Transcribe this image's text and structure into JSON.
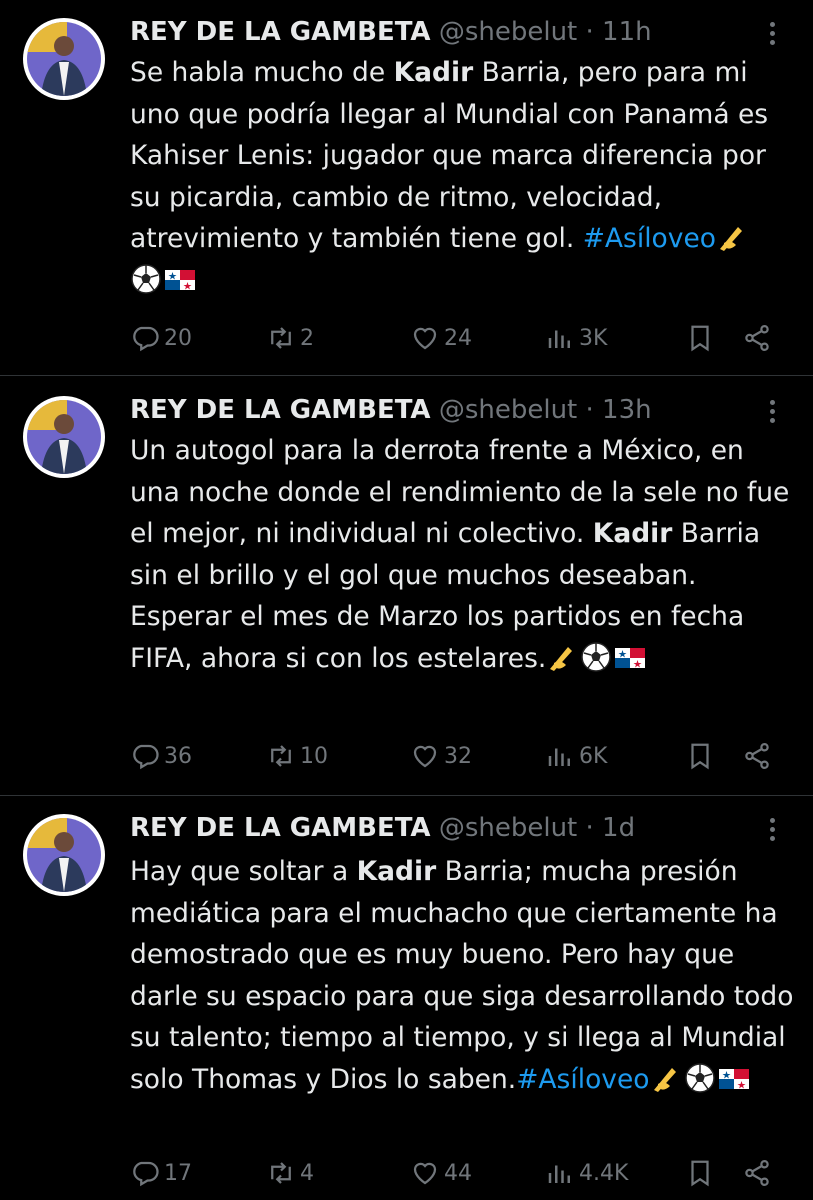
{
  "tweets": [
    {
      "name": "REY DE LA GAMBETA",
      "handle": "@shebelut",
      "separator": "·",
      "time": "11h",
      "text_parts": {
        "a": "Se habla mucho de ",
        "bold": "Kadir",
        "b": " Barria, pero para mi uno que podría llegar al Mundial con Panamá es Kahiser Lenis: jugador que marca diferencia por su picardia, cambio de ritmo, velocidad, atrevimiento y también tiene gol. ",
        "hashtag": "#Asíloveo"
      },
      "emojis": [
        "writing-hand",
        "soccer-ball",
        "panama-flag"
      ],
      "stats": {
        "replies": "20",
        "retweets": "2",
        "likes": "24",
        "views": "3K"
      }
    },
    {
      "name": "REY DE LA GAMBETA",
      "handle": "@shebelut",
      "separator": "·",
      "time": "13h",
      "text_parts": {
        "a": "Un autogol para la derrota frente a México, en una noche donde el rendimiento de la sele no fue el mejor, ni individual ni colectivo. ",
        "bold": "Kadir",
        "b": " Barria sin el brillo y el gol que muchos deseaban. Esperar el mes de Marzo los partidos en fecha FIFA, ahora si con los estelares.",
        "hashtag": ""
      },
      "emojis": [
        "writing-hand",
        "soccer-ball",
        "panama-flag"
      ],
      "stats": {
        "replies": "36",
        "retweets": "10",
        "likes": "32",
        "views": "6K"
      }
    },
    {
      "name": "REY DE LA GAMBETA",
      "handle": "@shebelut",
      "separator": "·",
      "time": "1d",
      "text_parts": {
        "a": "Hay que soltar a ",
        "bold": "Kadir",
        "b": " Barria; mucha presión mediática para el muchacho que ciertamente ha demostrado que es muy bueno. Pero hay que darle su espacio para que siga desarrollando todo su talento;  tiempo al tiempo, y si llega al Mundial solo Thomas y Dios lo saben.",
        "hashtag": "#Asíloveo"
      },
      "emojis": [
        "writing-hand",
        "soccer-ball",
        "panama-flag"
      ],
      "stats": {
        "replies": "17",
        "retweets": "4",
        "likes": "44",
        "views": "4.4K"
      }
    }
  ],
  "colors": {
    "background": "#000000",
    "text": "#e7e9ea",
    "muted": "#71767b",
    "link": "#1d9bf0",
    "divider": "#2f3336"
  },
  "icons": [
    "reply-icon",
    "retweet-icon",
    "like-icon",
    "views-icon",
    "bookmark-icon",
    "share-icon",
    "more-icon"
  ]
}
